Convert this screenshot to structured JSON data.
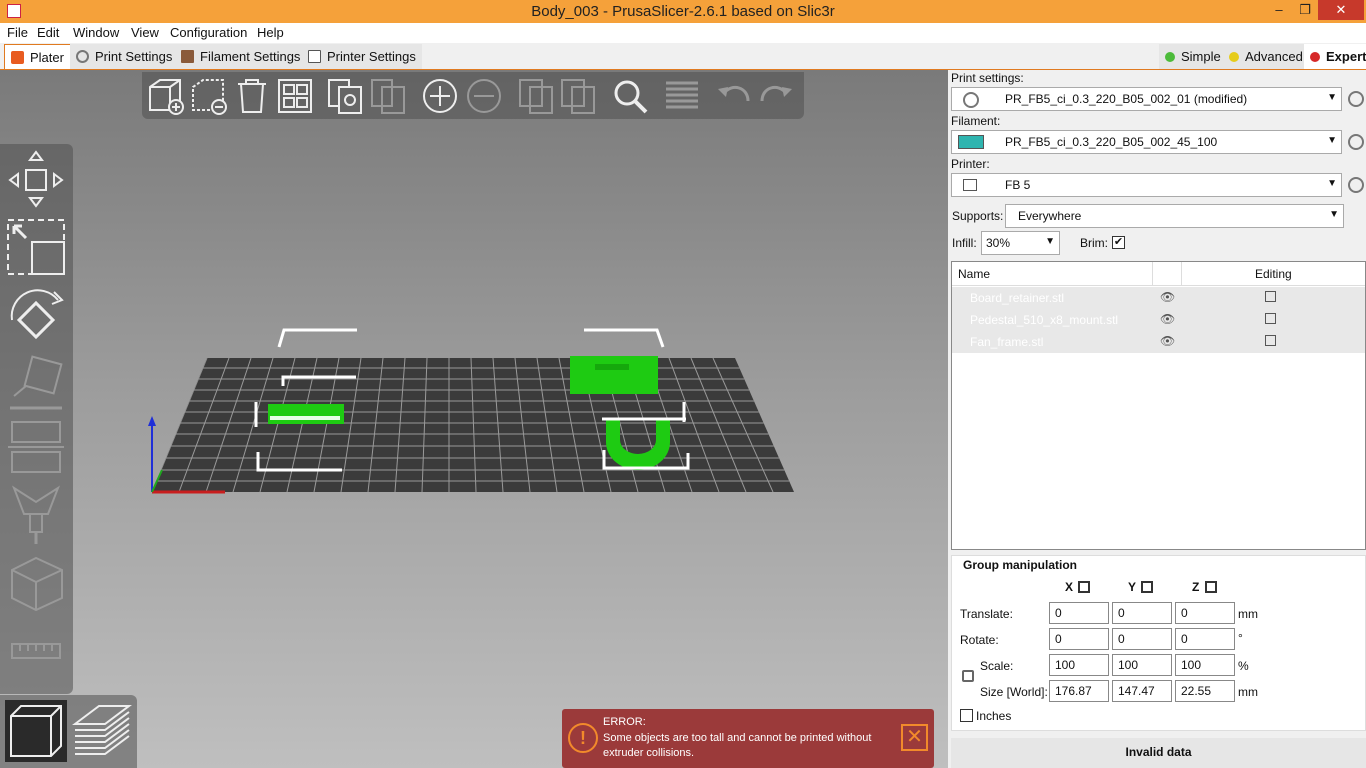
{
  "window": {
    "title": "Body_003 - PrusaSlicer-2.6.1 based on Slic3r",
    "min": "–",
    "max": "❐",
    "close": "✕"
  },
  "menu": [
    "File",
    "Edit",
    "Window",
    "View",
    "Configuration",
    "Help"
  ],
  "tabs": [
    {
      "label": "Plater",
      "active": true
    },
    {
      "label": "Print Settings"
    },
    {
      "label": "Filament Settings"
    },
    {
      "label": "Printer Settings"
    }
  ],
  "modes": [
    {
      "label": "Simple",
      "color": "#4cbb3a"
    },
    {
      "label": "Advanced",
      "color": "#e6cc1a"
    },
    {
      "label": "Expert",
      "color": "#d62828"
    }
  ],
  "sidebar": {
    "print_settings_label": "Print settings:",
    "print_settings_value": "PR_FB5_ci_0.3_220_B05_002_01 (modified)",
    "filament_label": "Filament:",
    "filament_value": "PR_FB5_ci_0.3_220_B05_002_45_100",
    "filament_color": "#2fb5b0",
    "printer_label": "Printer:",
    "printer_value": "FB 5",
    "supports_label": "Supports:",
    "supports_value": "Everywhere",
    "infill_label": "Infill:",
    "infill_value": "30%",
    "brim_label": "Brim:",
    "object_list": {
      "col_name": "Name",
      "col_editing": "Editing",
      "rows": [
        {
          "name": "Board_retainer.stl"
        },
        {
          "name": "Pedestal_510_x8_mount.stl"
        },
        {
          "name": "Fan_frame.stl"
        }
      ]
    },
    "group": {
      "title": "Group manipulation",
      "axes": [
        "X",
        "Y",
        "Z"
      ],
      "translate_label": "Translate:",
      "translate": [
        "0",
        "0",
        "0"
      ],
      "translate_unit": "mm",
      "rotate_label": "Rotate:",
      "rotate": [
        "0",
        "0",
        "0"
      ],
      "rotate_unit": "°",
      "scale_label": "Scale:",
      "scale": [
        "100",
        "100",
        "100"
      ],
      "scale_unit": "%",
      "size_label": "Size [World]:",
      "size": [
        "176.87",
        "147.47",
        "22.55"
      ],
      "size_unit": "mm",
      "inches_label": "Inches"
    },
    "action_button": "Invalid data"
  },
  "error": {
    "title": "ERROR:",
    "message": "Some objects are too tall and cannot be printed without extruder collisions."
  },
  "colors": {
    "accent": "#e07a20",
    "title_bar": "#f5a13a",
    "object_green": "#1ecb12",
    "error_bg": "#962828"
  }
}
